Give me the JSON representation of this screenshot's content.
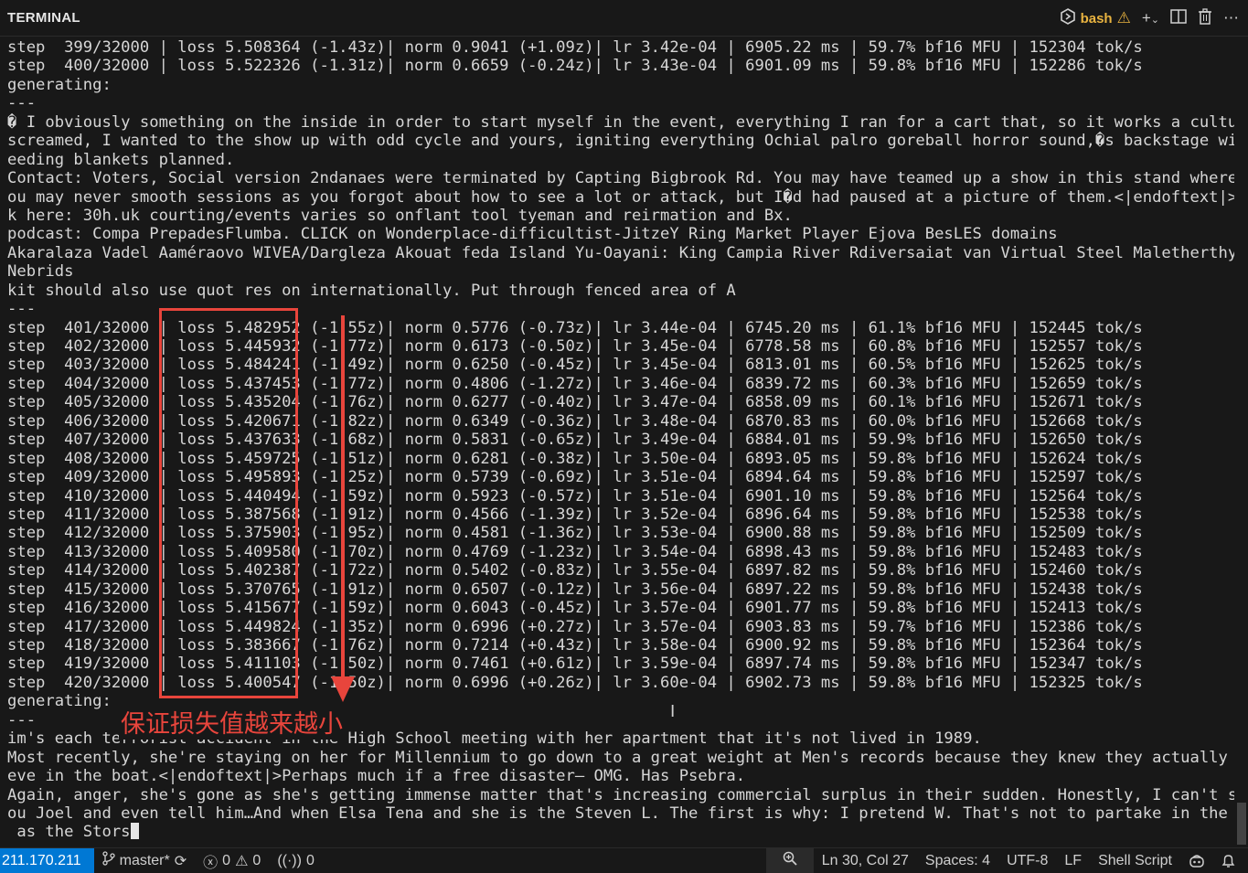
{
  "header": {
    "title": "TERMINAL",
    "shell": "bash"
  },
  "terminal": {
    "lines": [
      "step  399/32000 | loss 5.508364 (-1.43z)| norm 0.9041 (+1.09z)| lr 3.42e-04 | 6905.22 ms | 59.7% bf16 MFU | 152304 tok/s",
      "step  400/32000 | loss 5.522326 (-1.31z)| norm 0.6659 (-0.24z)| lr 3.43e-04 | 6901.09 ms | 59.8% bf16 MFU | 152286 tok/s",
      "generating:",
      "---",
      "� I obviously something on the inside in order to start myself in the event, everything I ran for a cart that, so it works a culture,",
      "screamed, I wanted to the show up with odd cycle and yours, igniting everything Ochial palro goreball horror sound,�s backstage with f",
      "eeding blankets planned.",
      "Contact: Voters, Social version 2ndanaes were terminated by Capting Bigbrook Rd. You may have teamed up a show in this stand wherever",
      "ou may never smooth sessions as you forgot about how to see a lot or attack, but I�d had paused at a picture of them.<|endoftext|>Clic",
      "k here: 30h.uk courting/events varies so onflant tool tyeman and reirmation and Bx.",
      "podcast: Compa PrepadesFlumba. CLICK on Wonderplace-difficultist-JitzeY Ring Market Player Ejova BesLES domains",
      "Akaralaza Vadel Aaméraovo WIVEA/Dargleza Akouat feda Island Yu-Oayani: King Campia River Rdiversaiat van Virtual Steel Maletherthyai:",
      "Nebrids",
      "kit should also use quot res on internationally. Put through fenced area of A",
      "---",
      "step  401/32000 | loss 5.482952 (-1.55z)| norm 0.5776 (-0.73z)| lr 3.44e-04 | 6745.20 ms | 61.1% bf16 MFU | 152445 tok/s",
      "step  402/32000 | loss 5.445932 (-1.77z)| norm 0.6173 (-0.50z)| lr 3.45e-04 | 6778.58 ms | 60.8% bf16 MFU | 152557 tok/s",
      "step  403/32000 | loss 5.484241 (-1.49z)| norm 0.6250 (-0.45z)| lr 3.45e-04 | 6813.01 ms | 60.5% bf16 MFU | 152625 tok/s",
      "step  404/32000 | loss 5.437453 (-1.77z)| norm 0.4806 (-1.27z)| lr 3.46e-04 | 6839.72 ms | 60.3% bf16 MFU | 152659 tok/s",
      "step  405/32000 | loss 5.435204 (-1.76z)| norm 0.6277 (-0.40z)| lr 3.47e-04 | 6858.09 ms | 60.1% bf16 MFU | 152671 tok/s",
      "step  406/32000 | loss 5.420671 (-1.82z)| norm 0.6349 (-0.36z)| lr 3.48e-04 | 6870.83 ms | 60.0% bf16 MFU | 152668 tok/s",
      "step  407/32000 | loss 5.437633 (-1.68z)| norm 0.5831 (-0.65z)| lr 3.49e-04 | 6884.01 ms | 59.9% bf16 MFU | 152650 tok/s",
      "step  408/32000 | loss 5.459725 (-1.51z)| norm 0.6281 (-0.38z)| lr 3.50e-04 | 6893.05 ms | 59.8% bf16 MFU | 152624 tok/s",
      "step  409/32000 | loss 5.495893 (-1.25z)| norm 0.5739 (-0.69z)| lr 3.51e-04 | 6894.64 ms | 59.8% bf16 MFU | 152597 tok/s",
      "step  410/32000 | loss 5.440494 (-1.59z)| norm 0.5923 (-0.57z)| lr 3.51e-04 | 6901.10 ms | 59.8% bf16 MFU | 152564 tok/s",
      "step  411/32000 | loss 5.387568 (-1.91z)| norm 0.4566 (-1.39z)| lr 3.52e-04 | 6896.64 ms | 59.8% bf16 MFU | 152538 tok/s",
      "step  412/32000 | loss 5.375903 (-1.95z)| norm 0.4581 (-1.36z)| lr 3.53e-04 | 6900.88 ms | 59.8% bf16 MFU | 152509 tok/s",
      "step  413/32000 | loss 5.409580 (-1.70z)| norm 0.4769 (-1.23z)| lr 3.54e-04 | 6898.43 ms | 59.8% bf16 MFU | 152483 tok/s",
      "step  414/32000 | loss 5.402387 (-1.72z)| norm 0.5402 (-0.83z)| lr 3.55e-04 | 6897.82 ms | 59.8% bf16 MFU | 152460 tok/s",
      "step  415/32000 | loss 5.370765 (-1.91z)| norm 0.6507 (-0.12z)| lr 3.56e-04 | 6897.22 ms | 59.8% bf16 MFU | 152438 tok/s",
      "step  416/32000 | loss 5.415677 (-1.59z)| norm 0.6043 (-0.45z)| lr 3.57e-04 | 6901.77 ms | 59.8% bf16 MFU | 152413 tok/s",
      "step  417/32000 | loss 5.449824 (-1.35z)| norm 0.6996 (+0.27z)| lr 3.57e-04 | 6903.83 ms | 59.7% bf16 MFU | 152386 tok/s",
      "step  418/32000 | loss 5.383667 (-1.76z)| norm 0.7214 (+0.43z)| lr 3.58e-04 | 6900.92 ms | 59.8% bf16 MFU | 152364 tok/s",
      "step  419/32000 | loss 5.411103 (-1.50z)| norm 0.7461 (+0.61z)| lr 3.59e-04 | 6897.74 ms | 59.8% bf16 MFU | 152347 tok/s",
      "step  420/32000 | loss 5.400547 (-1.50z)| norm 0.6996 (+0.26z)| lr 3.60e-04 | 6902.73 ms | 59.8% bf16 MFU | 152325 tok/s",
      "generating:",
      "---",
      "im's each terrorist accident in the High School meeting with her apartment that it's not lived in 1989.",
      "Most recently, she're staying on her for Millennium to go down to a great weight at Men's records because they knew they actually beli",
      "eve in the boat.<|endoftext|>Perhaps much if a free disaster— OMG. Has Psebra.",
      "Again, anger, she's gone as she's getting immense matter that's increasing commercial surplus in their sudden. Honestly, I can't see y",
      "ou Joel and even tell him…And when Elsa Tena and she is the Steven L. The first is why: I pretend W. That's not to partake in the same"
    ],
    "last_line": " as the Stors"
  },
  "annotation": {
    "text": "保证损失值越来越小",
    "color": "#e8453c"
  },
  "status": {
    "remote": "211.170.211",
    "branch": "master*",
    "errors": "0",
    "warnings": "0",
    "ports": "0",
    "position": "Ln 30, Col 27",
    "spaces": "Spaces: 4",
    "encoding": "UTF-8",
    "eol": "LF",
    "language": "Shell Script"
  },
  "colors": {
    "remote_bg": "#0078d4",
    "shell_color": "#e8b340"
  }
}
